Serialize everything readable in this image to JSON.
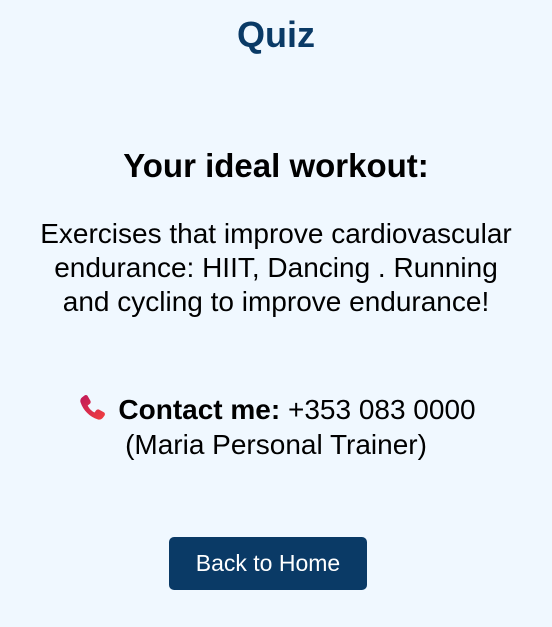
{
  "page": {
    "title": "Quiz"
  },
  "result": {
    "heading": "Your ideal workout:",
    "text": "Exercises that improve cardiovascular endurance: HIIT, Dancing . Running and cycling to improve endurance!"
  },
  "contact": {
    "icon": "phone-icon",
    "label": "Contact me:",
    "phone": " +353 083 0000",
    "name": "(Maria Personal Trainer)"
  },
  "actions": {
    "back_label": "Back to Home"
  },
  "colors": {
    "background": "#f0f8ff",
    "accent": "#0a3a66",
    "phone_icon": "#e8324a"
  }
}
